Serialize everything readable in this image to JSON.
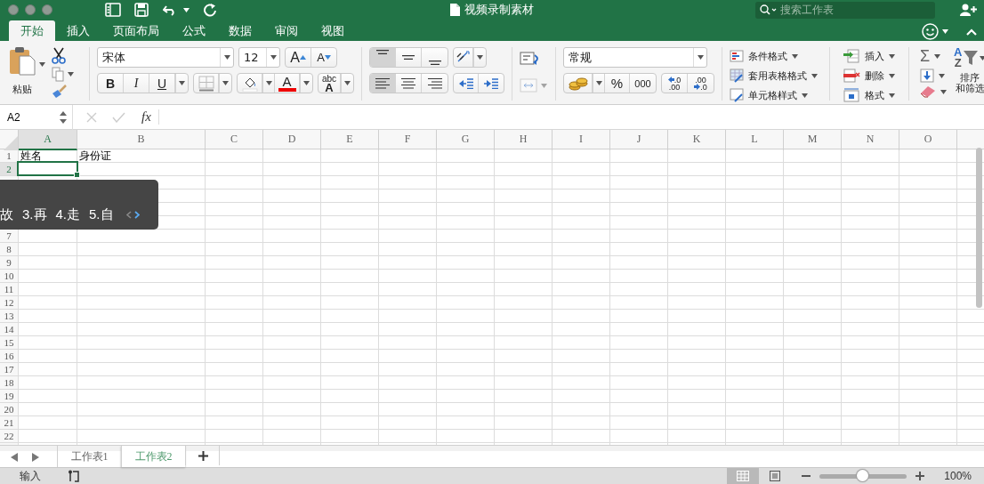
{
  "window": {
    "title": "视频录制素材",
    "search_placeholder": "搜索工作表"
  },
  "ribbon_tabs": [
    {
      "label": "开始",
      "selected": true
    },
    {
      "label": "插入",
      "selected": false
    },
    {
      "label": "页面布局",
      "selected": false
    },
    {
      "label": "公式",
      "selected": false
    },
    {
      "label": "数据",
      "selected": false
    },
    {
      "label": "审阅",
      "selected": false
    },
    {
      "label": "视图",
      "selected": false
    }
  ],
  "ribbon": {
    "paste": "粘贴",
    "font": {
      "name": "宋体",
      "size": "12",
      "grow": "A",
      "shrink": "A",
      "bold": "B",
      "italic": "I",
      "underline": "U",
      "color_letter": "A",
      "phonetic_top": "abc",
      "phonetic_bottom": "A"
    },
    "alignment": {
      "vertical": [
        {
          "kind": "top",
          "selected": true
        },
        {
          "kind": "middle",
          "selected": false
        },
        {
          "kind": "bottom",
          "selected": false
        }
      ],
      "horizontal": [
        {
          "kind": "left",
          "selected": true
        },
        {
          "kind": "center",
          "selected": false
        },
        {
          "kind": "right",
          "selected": false
        }
      ]
    },
    "number": {
      "format": "常规",
      "percent": "%",
      "comma": "000",
      "increase_decimal": [
        ".0",
        ".00"
      ],
      "decrease_decimal": [
        ".00",
        ".0"
      ]
    },
    "styles": [
      {
        "kind": "conditional",
        "label": "条件格式"
      },
      {
        "kind": "table",
        "label": "套用表格格式"
      },
      {
        "kind": "cell",
        "label": "单元格样式"
      }
    ],
    "cells": [
      {
        "kind": "insert",
        "label": "插入"
      },
      {
        "kind": "delete",
        "label": "删除"
      },
      {
        "kind": "format",
        "label": "格式"
      }
    ],
    "editing": {
      "sum": "Σ",
      "sort_letters": [
        "A",
        "Z"
      ],
      "sort_label": [
        "排序",
        "和筛选"
      ]
    }
  },
  "formula_bar": {
    "name_box": "A2",
    "fx": "fx"
  },
  "sheet": {
    "columns": [
      {
        "label": "A",
        "selected": true
      },
      {
        "label": "B",
        "selected": false
      },
      {
        "label": "C",
        "selected": false
      },
      {
        "label": "D",
        "selected": false
      },
      {
        "label": "E",
        "selected": false
      },
      {
        "label": "F",
        "selected": false
      },
      {
        "label": "G",
        "selected": false
      },
      {
        "label": "H",
        "selected": false
      },
      {
        "label": "I",
        "selected": false
      },
      {
        "label": "J",
        "selected": false
      },
      {
        "label": "K",
        "selected": false
      },
      {
        "label": "L",
        "selected": false
      },
      {
        "label": "M",
        "selected": false
      },
      {
        "label": "N",
        "selected": false
      },
      {
        "label": "O",
        "selected": false
      }
    ],
    "rows": [
      {
        "number": "1",
        "selected": false,
        "cells": [
          "姓名",
          "身份证"
        ]
      },
      {
        "number": "2",
        "selected": true
      },
      {
        "kind": "covered"
      },
      {
        "kind": "covered"
      },
      {
        "kind": "covered"
      },
      {
        "kind": "covered"
      },
      {
        "number": "7",
        "selected": false
      },
      {
        "number": "8",
        "selected": false
      },
      {
        "number": "9",
        "selected": false
      },
      {
        "number": "10",
        "selected": false
      },
      {
        "number": "11",
        "selected": false
      },
      {
        "number": "12",
        "selected": false
      },
      {
        "number": "13",
        "selected": false
      },
      {
        "number": "14",
        "selected": false
      },
      {
        "number": "15",
        "selected": false
      },
      {
        "number": "16",
        "selected": false
      },
      {
        "number": "17",
        "selected": false
      },
      {
        "number": "18",
        "selected": false
      },
      {
        "number": "19",
        "selected": false
      },
      {
        "number": "20",
        "selected": false
      },
      {
        "number": "21",
        "selected": false
      },
      {
        "number": "22",
        "selected": false
      }
    ]
  },
  "ime_candidates": [
    "故",
    "3.再",
    "4.走",
    "5.自"
  ],
  "sheet_tabs": [
    {
      "label": "工作表1",
      "selected": false
    },
    {
      "label": "工作表2",
      "selected": true
    }
  ],
  "status": {
    "mode": "输入",
    "views": [
      {
        "kind": "normal",
        "selected": true
      },
      {
        "kind": "page_layout",
        "selected": false
      }
    ],
    "zoom_slider": {
      "level": 0.5
    },
    "zoom": "100%"
  }
}
